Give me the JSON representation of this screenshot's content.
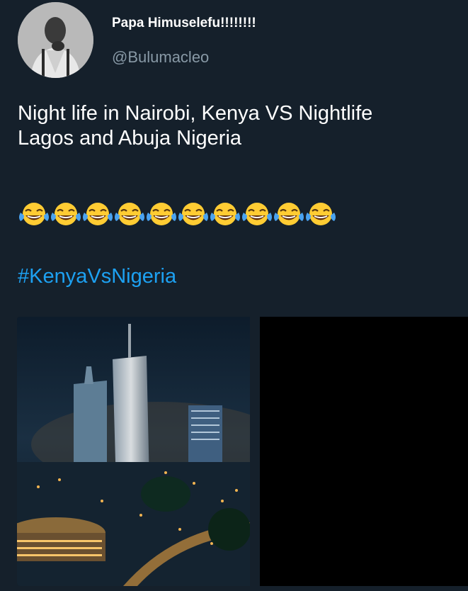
{
  "user": {
    "display_name": "Papa Himuselefu!!!!!!!!",
    "handle": "@Bulumacleo",
    "avatar_icon": "profile-photo"
  },
  "tweet": {
    "text_line1": "Night life in Nairobi, Kenya VS Nightlife",
    "text_line2": "Lagos and Abuja Nigeria",
    "emoji": "😂",
    "emoji_count": 10,
    "hashtag": "#KenyaVsNigeria"
  },
  "colors": {
    "background": "#15202b",
    "handle": "#8899a6",
    "link": "#1da1f2"
  }
}
